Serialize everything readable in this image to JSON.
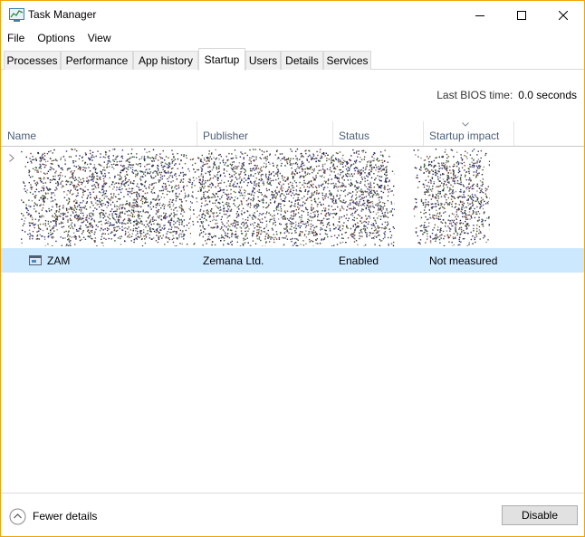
{
  "window": {
    "title": "Task Manager"
  },
  "menu": [
    "File",
    "Options",
    "View"
  ],
  "tabs": [
    {
      "label": "Processes"
    },
    {
      "label": "Performance"
    },
    {
      "label": "App history"
    },
    {
      "label": "Startup"
    },
    {
      "label": "Users"
    },
    {
      "label": "Details"
    },
    {
      "label": "Services"
    }
  ],
  "active_tab": "Startup",
  "bios": {
    "label": "Last BIOS time:",
    "value": "0.0 seconds"
  },
  "columns": [
    "Name",
    "Publisher",
    "Status",
    "Startup impact"
  ],
  "selected_row": {
    "name": "ZAM",
    "publisher": "Zemana Ltd.",
    "status": "Enabled",
    "impact": "Not measured"
  },
  "footer": {
    "fewer_details": "Fewer details",
    "disable": "Disable"
  },
  "colors": {
    "window_border": "#f0a30a",
    "selection": "#cce8ff",
    "header_text": "#4c607a"
  }
}
